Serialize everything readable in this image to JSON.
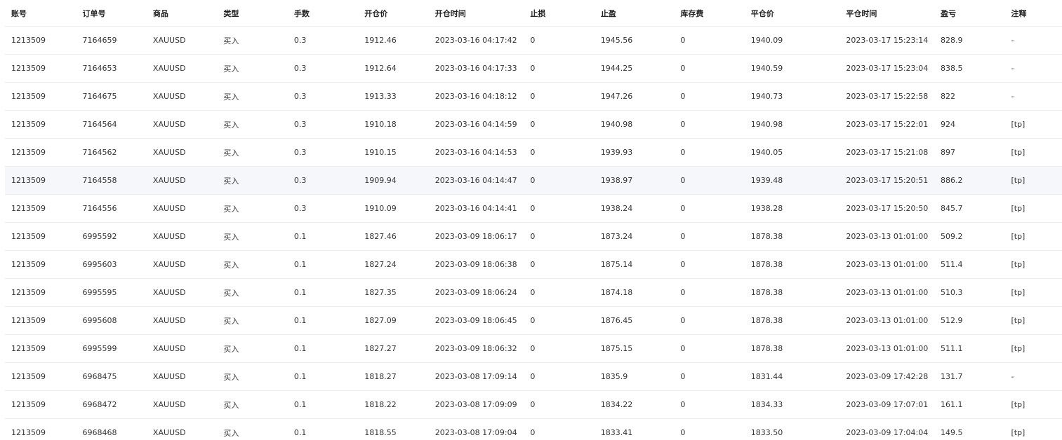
{
  "table": {
    "headers": [
      "账号",
      "订单号",
      "商品",
      "类型",
      "手数",
      "开仓价",
      "开仓时间",
      "止损",
      "止盈",
      "库存费",
      "平仓价",
      "平仓时间",
      "盈亏",
      "注释"
    ],
    "rows": [
      [
        "1213509",
        "7164659",
        "XAUUSD",
        "买入",
        "0.3",
        "1912.46",
        "2023-03-16 04:17:42",
        "0",
        "1945.56",
        "0",
        "1940.09",
        "2023-03-17 15:23:14",
        "828.9",
        "-"
      ],
      [
        "1213509",
        "7164653",
        "XAUUSD",
        "买入",
        "0.3",
        "1912.64",
        "2023-03-16 04:17:33",
        "0",
        "1944.25",
        "0",
        "1940.59",
        "2023-03-17 15:23:04",
        "838.5",
        "-"
      ],
      [
        "1213509",
        "7164675",
        "XAUUSD",
        "买入",
        "0.3",
        "1913.33",
        "2023-03-16 04:18:12",
        "0",
        "1947.26",
        "0",
        "1940.73",
        "2023-03-17 15:22:58",
        "822",
        "-"
      ],
      [
        "1213509",
        "7164564",
        "XAUUSD",
        "买入",
        "0.3",
        "1910.18",
        "2023-03-16 04:14:59",
        "0",
        "1940.98",
        "0",
        "1940.98",
        "2023-03-17 15:22:01",
        "924",
        "[tp]"
      ],
      [
        "1213509",
        "7164562",
        "XAUUSD",
        "买入",
        "0.3",
        "1910.15",
        "2023-03-16 04:14:53",
        "0",
        "1939.93",
        "0",
        "1940.05",
        "2023-03-17 15:21:08",
        "897",
        "[tp]"
      ],
      [
        "1213509",
        "7164558",
        "XAUUSD",
        "买入",
        "0.3",
        "1909.94",
        "2023-03-16 04:14:47",
        "0",
        "1938.97",
        "0",
        "1939.48",
        "2023-03-17 15:20:51",
        "886.2",
        "[tp]"
      ],
      [
        "1213509",
        "7164556",
        "XAUUSD",
        "买入",
        "0.3",
        "1910.09",
        "2023-03-16 04:14:41",
        "0",
        "1938.24",
        "0",
        "1938.28",
        "2023-03-17 15:20:50",
        "845.7",
        "[tp]"
      ],
      [
        "1213509",
        "6995592",
        "XAUUSD",
        "买入",
        "0.1",
        "1827.46",
        "2023-03-09 18:06:17",
        "0",
        "1873.24",
        "0",
        "1878.38",
        "2023-03-13 01:01:00",
        "509.2",
        "[tp]"
      ],
      [
        "1213509",
        "6995603",
        "XAUUSD",
        "买入",
        "0.1",
        "1827.24",
        "2023-03-09 18:06:38",
        "0",
        "1875.14",
        "0",
        "1878.38",
        "2023-03-13 01:01:00",
        "511.4",
        "[tp]"
      ],
      [
        "1213509",
        "6995595",
        "XAUUSD",
        "买入",
        "0.1",
        "1827.35",
        "2023-03-09 18:06:24",
        "0",
        "1874.18",
        "0",
        "1878.38",
        "2023-03-13 01:01:00",
        "510.3",
        "[tp]"
      ],
      [
        "1213509",
        "6995608",
        "XAUUSD",
        "买入",
        "0.1",
        "1827.09",
        "2023-03-09 18:06:45",
        "0",
        "1876.45",
        "0",
        "1878.38",
        "2023-03-13 01:01:00",
        "512.9",
        "[tp]"
      ],
      [
        "1213509",
        "6995599",
        "XAUUSD",
        "买入",
        "0.1",
        "1827.27",
        "2023-03-09 18:06:32",
        "0",
        "1875.15",
        "0",
        "1878.38",
        "2023-03-13 01:01:00",
        "511.1",
        "[tp]"
      ],
      [
        "1213509",
        "6968475",
        "XAUUSD",
        "买入",
        "0.1",
        "1818.27",
        "2023-03-08 17:09:14",
        "0",
        "1835.9",
        "0",
        "1831.44",
        "2023-03-09 17:42:28",
        "131.7",
        "-"
      ],
      [
        "1213509",
        "6968472",
        "XAUUSD",
        "买入",
        "0.1",
        "1818.22",
        "2023-03-08 17:09:09",
        "0",
        "1834.22",
        "0",
        "1834.33",
        "2023-03-09 17:07:01",
        "161.1",
        "[tp]"
      ],
      [
        "1213509",
        "6968468",
        "XAUUSD",
        "买入",
        "0.1",
        "1818.55",
        "2023-03-08 17:09:04",
        "0",
        "1833.41",
        "0",
        "1833.50",
        "2023-03-09 17:04:04",
        "149.5",
        "[tp]"
      ]
    ],
    "highlighted_row_index": 5
  },
  "colors": {
    "header_text": "#222222",
    "cell_text": "#333333",
    "row_border": "#ebeef5",
    "highlight_bg": "#f5f7fa"
  }
}
